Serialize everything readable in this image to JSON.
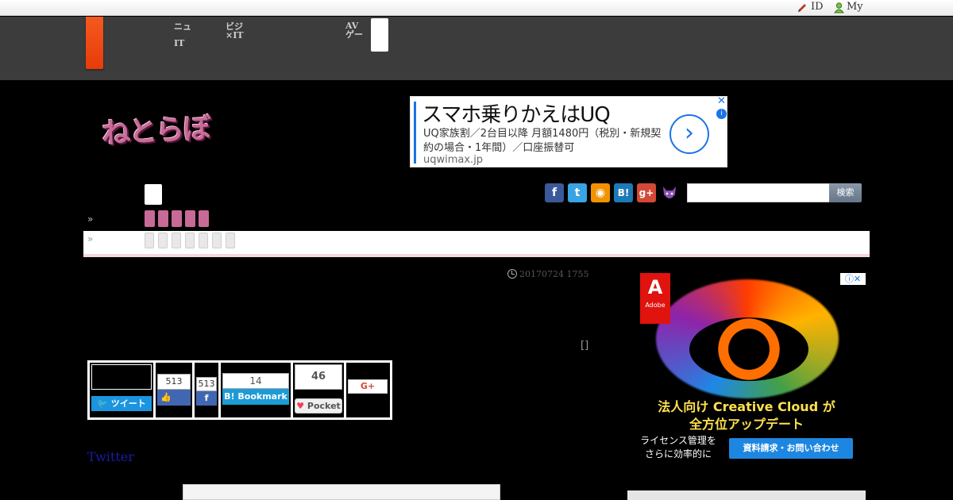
{
  "util_bar": {
    "id_label": "ID",
    "my_label": "My"
  },
  "nav": {
    "col1": [
      "ニュ",
      "IT"
    ],
    "col2": [
      "ビジ",
      "×IT"
    ],
    "col3": [
      "AV",
      "ゲー"
    ]
  },
  "brand": {
    "logo_text": "ねとらぼ"
  },
  "top_ad": {
    "headline": "スマホ乗りかえはUQ",
    "body": "UQ家族割／2台目以降 月額1480円（税別・新規契約の場合・1年間）／口座振替可",
    "url": "uqwimax.jp",
    "arrow": "›",
    "close": "✕",
    "info": "i"
  },
  "search": {
    "button_label": "検索",
    "placeholder": ""
  },
  "social_icons": [
    "facebook-icon",
    "twitter-icon",
    "rss-icon",
    "hatena-icon",
    "googleplus-icon",
    "cat-icon"
  ],
  "breadcrumb_marks": [
    "»",
    "»"
  ],
  "article": {
    "date": "20170724 1755",
    "bracket": "[]"
  },
  "share": {
    "tweet_label": "ツイート",
    "like_count": "513",
    "fb_count": "513",
    "bookmark_count": "14",
    "bookmark_label": "Bookmark",
    "pocket_count": "46",
    "pocket_label": "Pocket",
    "gplus_label": "G+"
  },
  "twitter_link": "Twitter",
  "side_ad": {
    "brand": "Adobe",
    "headline1": "法人向け Creative Cloud が",
    "headline2": "全方位アップデート",
    "sub": "ライセンス管理を さらに効率的に",
    "button": "資料請求・お問い合わせ",
    "info_label": "ⓘ✕"
  },
  "colors": {
    "nav_bg": "#3c3c3c",
    "accent_orange": "#e83b0a",
    "brand_pink": "#c86a97",
    "link_blue": "#1a1aa6"
  }
}
